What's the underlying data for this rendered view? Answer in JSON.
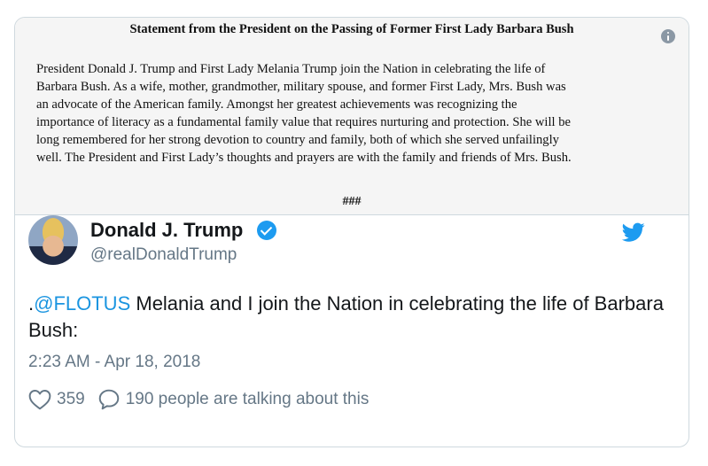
{
  "embedded_statement": {
    "title": "Statement from the President on the Passing of Former First Lady Barbara Bush",
    "lines": [
      "President Donald J. Trump and First Lady Melania Trump join the Nation in celebrating the life of",
      "Barbara Bush. As a wife, mother, grandmother, military spouse, and former First Lady, Mrs. Bush was",
      "an advocate of the American family. Amongst her greatest achievements was recognizing the",
      "importance of literacy as a fundamental family value that requires nurturing and protection. She will be",
      "long remembered for her strong devotion to country and family, both of which she served unfailingly",
      "well. The President and First Lady’s thoughts and prayers are with the family and friends of Mrs. Bush."
    ],
    "end_mark": "###",
    "info_icon": "info-icon"
  },
  "tweet": {
    "display_name": "Donald J. Trump",
    "handle": "@realDonaldTrump",
    "verified_icon": "verified-badge-icon",
    "platform_icon": "twitter-bird-icon",
    "text_prefix": ".",
    "mention": "@FLOTUS",
    "text_rest": " Melania and I join the Nation in celebrating the life of Barbara Bush:",
    "timestamp": "2:23 AM - Apr 18, 2018",
    "likes": "359",
    "talking": "190 people are talking about this"
  },
  "colors": {
    "accent": "#1b95e0",
    "muted": "#657786",
    "text": "#14171a"
  }
}
